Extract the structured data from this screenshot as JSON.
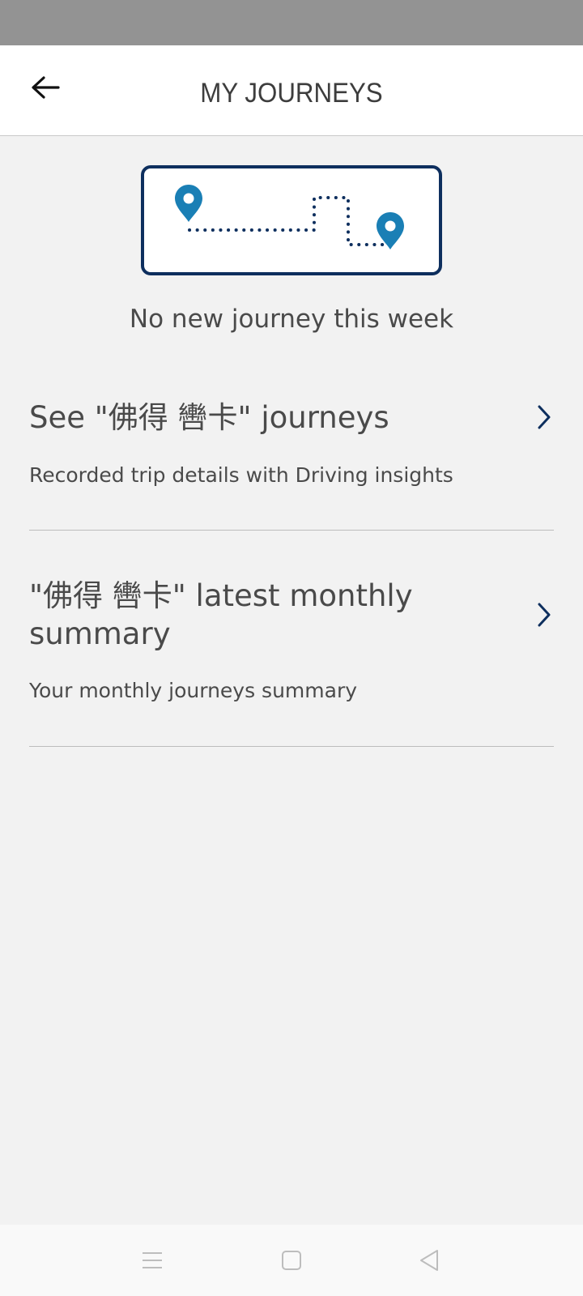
{
  "header": {
    "title": "MY JOURNEYS"
  },
  "empty_state": {
    "message": "No new journey this week"
  },
  "journeys_link": {
    "title": "See \"佛得 轡卡\" journeys",
    "subtitle": "Recorded trip details with Driving insights"
  },
  "summary_link": {
    "title": "\"佛得 轡卡\" latest monthly summary",
    "subtitle": "Your monthly journeys summary"
  },
  "colors": {
    "status_bar": "#939393",
    "background": "#f2f2f2",
    "accent_blue": "#1a7fb5",
    "navy": "#0e2f5e"
  },
  "icons": {
    "back": "arrow-left-icon",
    "chevron": "chevron-right-icon",
    "pin": "map-pin-icon",
    "menu": "menu-icon",
    "home": "square-home-icon",
    "back_nav": "triangle-back-icon"
  }
}
